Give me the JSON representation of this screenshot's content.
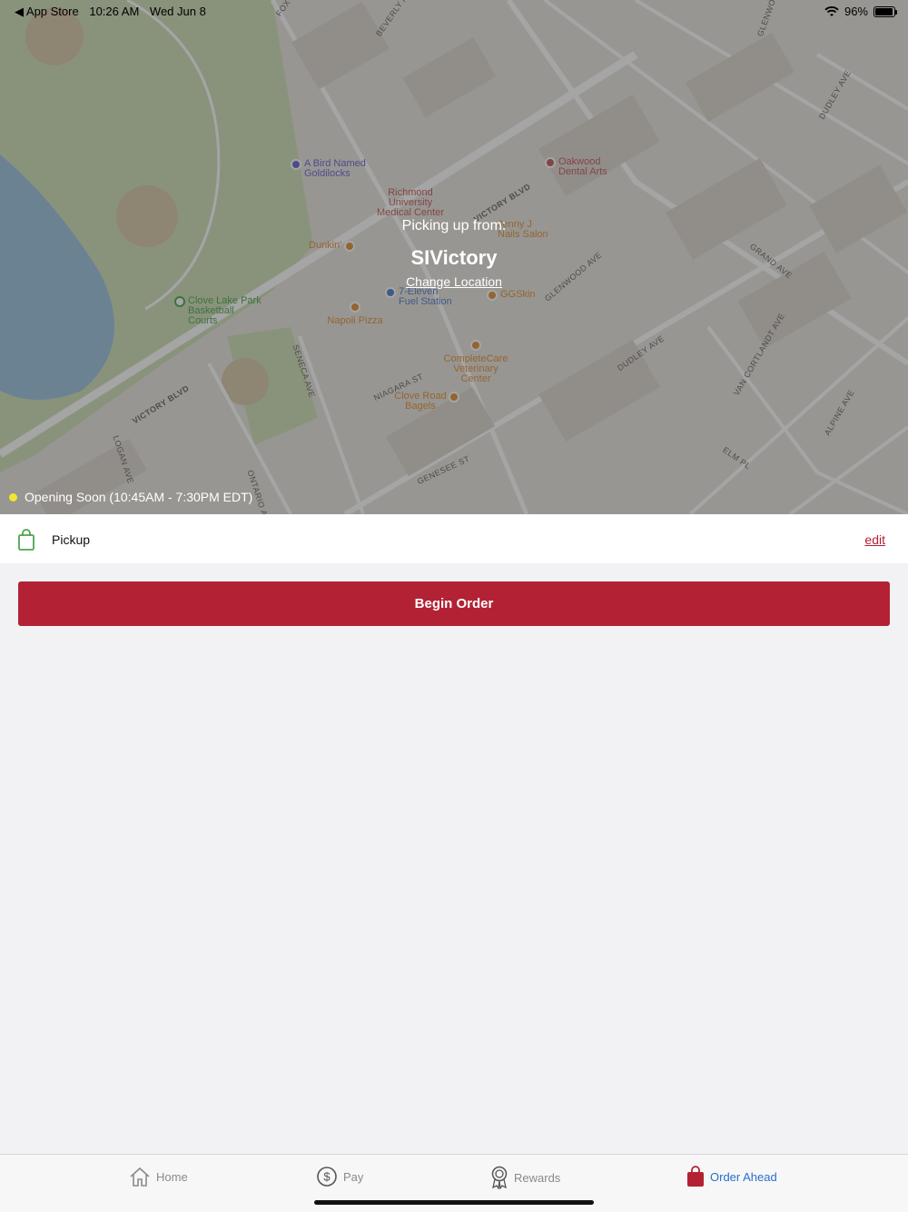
{
  "status_bar": {
    "back_app": "◀ App Store",
    "time": "10:26 AM",
    "date": "Wed Jun 8",
    "battery": "96%",
    "battery_level": 0.96
  },
  "map": {
    "pois": [
      {
        "name": "A Bird Named Goldilocks",
        "color": "#6a63d6"
      },
      {
        "name": "Richmond University Medical Center",
        "color": "#c45a5a"
      },
      {
        "name": "Oakwood Dental Arts",
        "color": "#c45a5a"
      },
      {
        "name": "Dunkin'",
        "color": "#e0913a"
      },
      {
        "name": "Jenny J Nails Salon",
        "color": "#e0913a"
      },
      {
        "name": "7-Eleven Fuel Station",
        "color": "#4f7fd1"
      },
      {
        "name": "GGSkin",
        "color": "#e0913a"
      },
      {
        "name": "Clove Lake Park Basketball Courts",
        "color": "#4ca64c"
      },
      {
        "name": "Napoli Pizza",
        "color": "#e0913a"
      },
      {
        "name": "CompleteCare Veterinary Center",
        "color": "#e0913a"
      },
      {
        "name": "Clove Road Bagels",
        "color": "#e0913a"
      }
    ],
    "streets": [
      "VICTORY BLVD",
      "VICTORY BLVD",
      "BEVERLY AVE",
      "GLENWOOD AVE",
      "DUDLEY AVE",
      "DUDLEY AVE",
      "GRAND AVE",
      "VAN CORTLANDT AVE",
      "ALPINE AVE",
      "ELM PL",
      "SENECA AVE",
      "NIAGARA ST",
      "GENESEE ST",
      "LOGAN AVE",
      "ONTARIO AVE",
      "GLENWOOD",
      "FOX"
    ]
  },
  "pickup_info": {
    "picking_up_label": "Picking up from:",
    "store_name": "SIVictory",
    "change_location": "Change Location",
    "hours": "Opening Soon (10:45AM - 7:30PM EDT)"
  },
  "pickup_row": {
    "label": "Pickup",
    "edit": "edit"
  },
  "begin_order": "Begin Order",
  "tabbar": {
    "items": [
      {
        "label": "Home",
        "icon": "home-icon",
        "active": false
      },
      {
        "label": "Pay",
        "icon": "dollar-icon",
        "active": false
      },
      {
        "label": "Rewards",
        "icon": "award-icon",
        "active": false
      },
      {
        "label": "Order Ahead",
        "icon": "bag-icon",
        "active": true
      }
    ]
  },
  "colors": {
    "accent": "#b22234",
    "tab_active": "#2a6fcf",
    "status_dot": "#f4e532"
  }
}
